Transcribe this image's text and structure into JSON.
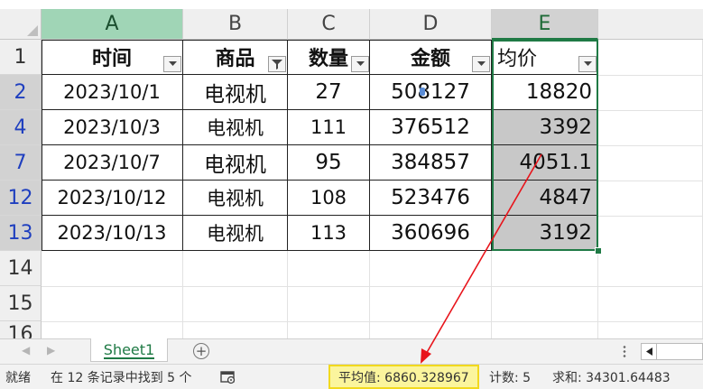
{
  "columns": [
    "A",
    "B",
    "C",
    "D",
    "E"
  ],
  "row_numbers": [
    "1",
    "2",
    "4",
    "7",
    "12",
    "13",
    "14",
    "15",
    "16"
  ],
  "header_row": [
    "时间",
    "商品",
    "数量",
    "金额",
    "均价"
  ],
  "rows": [
    [
      "2023/10/1",
      "电视机",
      "27",
      "508127",
      "18820"
    ],
    [
      "2023/10/3",
      "电视机",
      "111",
      "376512",
      "3392"
    ],
    [
      "2023/10/7",
      "电视机",
      "95",
      "384857",
      "4051.1"
    ],
    [
      "2023/10/12",
      "电视机",
      "108",
      "523476",
      "4847"
    ],
    [
      "2023/10/13",
      "电视机",
      "113",
      "360696",
      "3192"
    ]
  ],
  "sheet_tab": "Sheet1",
  "add_sheet_symbol": "⊕",
  "status": {
    "ready": "就绪",
    "filter_result": "在 12 条记录中找到 5 个",
    "average": "平均值: 6860.328967",
    "count": "计数: 5",
    "sum": "求和: 34301.64483"
  },
  "colors": {
    "selection": "#1f7a45",
    "filtered_row_number": "#1f3fbf",
    "highlight": "#fbf59d",
    "arrow": "#e8141b"
  }
}
